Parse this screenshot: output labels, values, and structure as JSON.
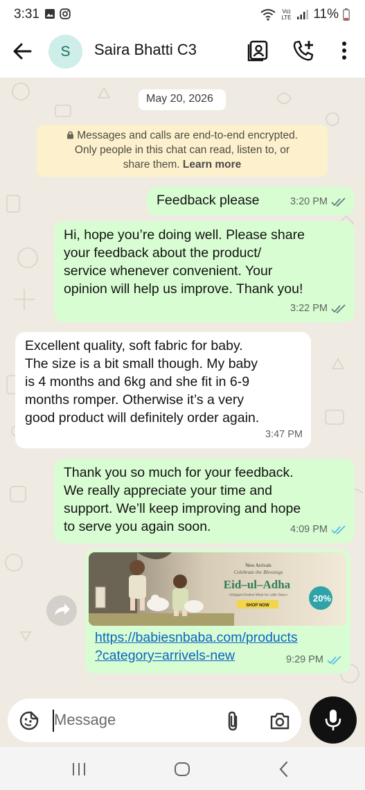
{
  "status_bar": {
    "time": "3:31",
    "battery": "11%",
    "network_label": "Vo) LTE"
  },
  "header": {
    "avatar_initial": "S",
    "contact_name": "Saira Bhatti C3",
    "icons": [
      "back-arrow-icon",
      "contact-card-icon",
      "add-call-icon",
      "more-vert-icon"
    ]
  },
  "chat": {
    "date_chip": "May 20, 2026",
    "encryption_notice": {
      "line1": "Messages and calls are end-to-end encrypted.",
      "line2": "Only people in this chat can read, listen to, or",
      "line3_text": "share them. ",
      "learn_more": "Learn more"
    },
    "messages": [
      {
        "direction": "outgoing",
        "lines": [
          "Feedback please"
        ],
        "time": "3:20 PM",
        "status": "read"
      },
      {
        "direction": "outgoing",
        "lines": [
          "Hi, hope you’re doing well. Please share",
          "your feedback about the product/",
          "service whenever convenient. Your",
          "opinion will help us improve. Thank you!"
        ],
        "time": "3:22 PM",
        "status": "read"
      },
      {
        "direction": "incoming",
        "lines": [
          "Excellent quality, soft fabric for baby.",
          "The size is a bit small though. My baby",
          "is 4 months and 6kg and she fit in 6-9",
          "months romper. Otherwise it’s a very",
          "good product will definitely order again."
        ],
        "time": "3:47 PM"
      },
      {
        "direction": "outgoing",
        "lines": [
          "Thank you so much for your feedback.",
          "We really appreciate your time and",
          "support. We’ll keep improving and hope",
          "to serve you again soon."
        ],
        "time": "4:09 PM",
        "status": "read"
      },
      {
        "direction": "outgoing",
        "type": "link_preview",
        "banner": {
          "kicker": "New Arrivals",
          "subtitle": "Celebrate the Blessings",
          "title": "Eid–ul–Adha",
          "tagline": "• Elegant Festive Wear for Little Stars •",
          "cta": "SHOP NOW",
          "badge": "20%"
        },
        "link_lines": [
          "https://babiesnbaba.com/products",
          "?category=arrivels-new"
        ],
        "time": "9:29 PM",
        "status": "read"
      }
    ]
  },
  "input": {
    "placeholder": "Message",
    "icons": [
      "sticker-icon",
      "attach-icon",
      "camera-icon",
      "mic-icon",
      "forward-icon"
    ]
  },
  "nav_bar": {
    "icons": [
      "recent-apps-icon",
      "home-icon",
      "back-icon"
    ]
  },
  "colors": {
    "outgoing_bubble": "#d9fdd3",
    "incoming_bubble": "#ffffff",
    "chat_background": "#efeae2",
    "read_ticks": "#53bdeb",
    "link": "#0b64c4",
    "notice_background": "#fdf1cd"
  }
}
